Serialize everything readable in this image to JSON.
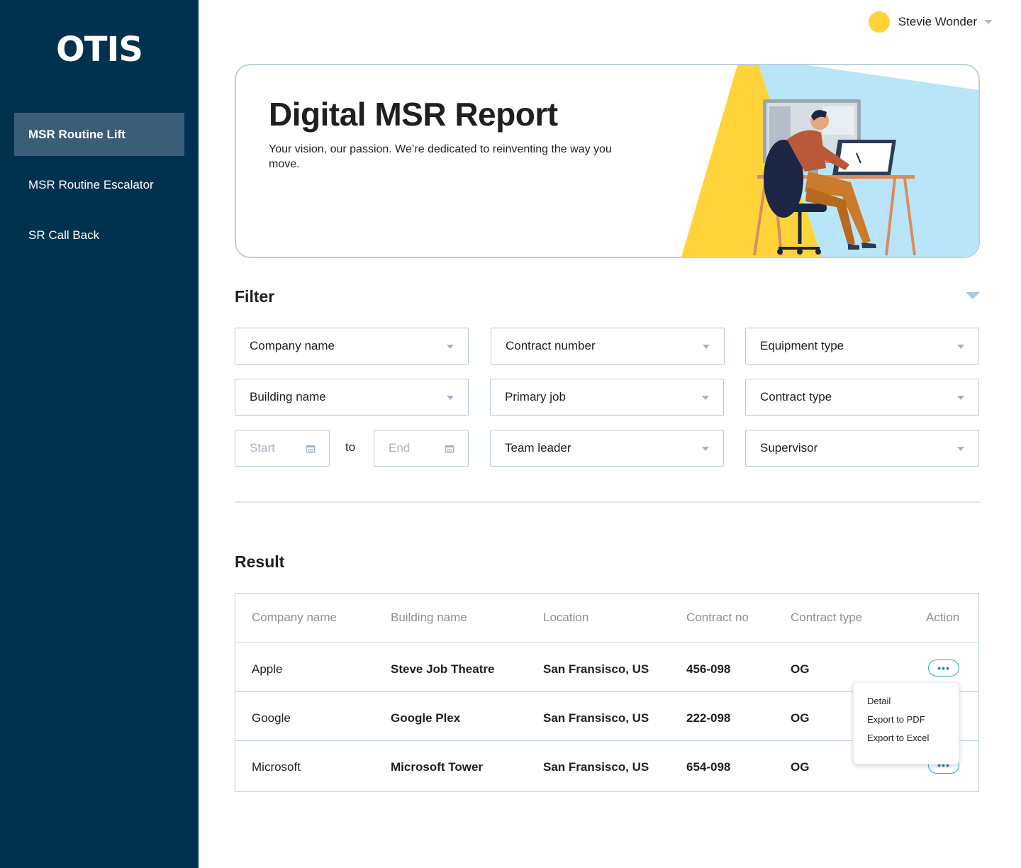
{
  "sidebar": {
    "logo": "OTIS",
    "items": [
      {
        "label": "MSR Routine Lift",
        "active": true
      },
      {
        "label": "MSR Routine Escalator",
        "active": false
      },
      {
        "label": "SR Call Back",
        "active": false
      }
    ]
  },
  "user": {
    "name": "Stevie Wonder",
    "icon": "chevron-down-icon"
  },
  "hero": {
    "title": "Digital MSR Report",
    "subtitle": "Your vision, our passion. We’re dedicated to reinventing the way you move."
  },
  "filter": {
    "title": "Filter",
    "company_name": "Company name",
    "contract_number": "Contract number",
    "equipment_type": "Equipment type",
    "building_name": "Building name",
    "primary_job": "Primary job",
    "contract_type": "Contract type",
    "start_placeholder": "Start",
    "to_label": "to",
    "end_placeholder": "End",
    "team_leader": "Team leader",
    "supervisor": "Supervisor"
  },
  "result": {
    "title": "Result",
    "columns": [
      "Company name",
      "Building name",
      "Location",
      "Contract no",
      "Contract type",
      "Action"
    ],
    "rows": [
      {
        "company": "Apple",
        "building": "Steve Job Theatre",
        "location": "San Fransisco, US",
        "contract_no": "456-098",
        "contract_type": "OG"
      },
      {
        "company": "Google",
        "building": "Google Plex",
        "location": "San Fransisco, US",
        "contract_no": "222-098",
        "contract_type": "OG"
      },
      {
        "company": "Microsoft",
        "building": "Microsoft Tower",
        "location": "San Fransisco, US",
        "contract_no": "654-098",
        "contract_type": "OG"
      }
    ],
    "action_label": "•••",
    "menu": [
      "Detail",
      "Export to PDF",
      "Export to Excel"
    ]
  },
  "colors": {
    "sidebar_bg": "#003250",
    "sidebar_active": "#3a5d78",
    "accent_yellow": "#ffd43b",
    "accent_blue": "#3a98d4",
    "border": "#bccfe0"
  }
}
